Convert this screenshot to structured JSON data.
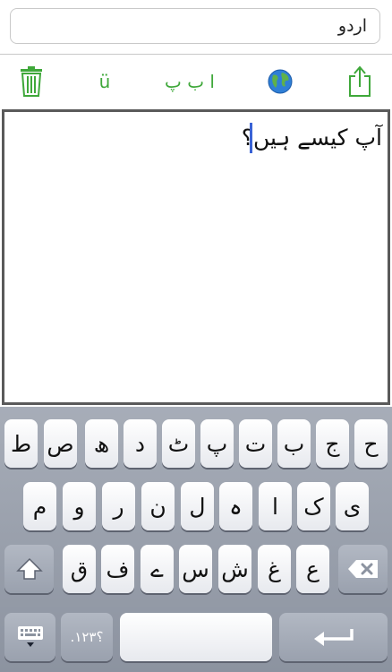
{
  "language_field": {
    "value": "اردو"
  },
  "toolbar": {
    "trash_icon": "trash-icon",
    "umlaut_label": "ü",
    "letters_label": "ا ب پ",
    "globe_icon": "globe-icon",
    "share_icon": "share-icon"
  },
  "editor": {
    "text": "آپ کیسے ہیں؟"
  },
  "keyboard": {
    "row1": [
      "ح",
      "ج",
      "ب",
      "ت",
      "پ",
      "ٹ",
      "د",
      "ھ",
      "ص",
      "ط"
    ],
    "row2": [
      "ی",
      "ک",
      "ا",
      "ہ",
      "ل",
      "ن",
      "ر",
      "و",
      "م"
    ],
    "row3": [
      "ع",
      "غ",
      "ش",
      "س",
      "ے",
      "ف",
      "ق"
    ],
    "numbers_label": ".؟۱۲۳",
    "shift_icon": "shift-icon",
    "backspace_icon": "backspace-icon",
    "keyboard_icon": "keyboard-icon",
    "return_icon": "return-icon"
  }
}
